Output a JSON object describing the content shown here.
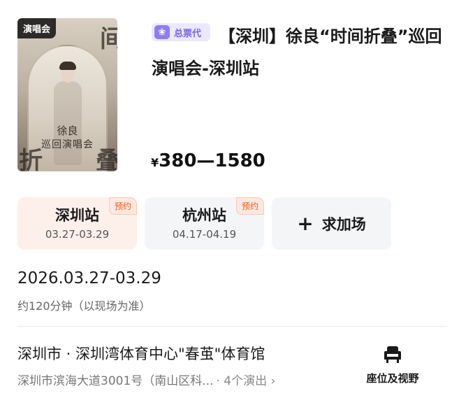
{
  "poster": {
    "tag": "演唱会",
    "title_line1": "徐良",
    "title_line2": "巡回演唱会",
    "char_top": "间",
    "char_bottom_left": "折",
    "char_bottom_right": "叠"
  },
  "badge": {
    "text": "总票代"
  },
  "title": "【深圳】徐良“时间折叠”巡回演唱会-深圳站",
  "price": {
    "currency": "¥",
    "range": "380—1580"
  },
  "cities": [
    {
      "name": "深圳站",
      "date": "03.27-03.29",
      "tag": "预约",
      "selected": true
    },
    {
      "name": "杭州站",
      "date": "04.17-04.19",
      "tag": "预约",
      "selected": false
    }
  ],
  "add_session": {
    "icon": "+",
    "label": "求加场"
  },
  "datetime": "2026.03.27-03.29",
  "duration": "约120分钟（以现场为准）",
  "venue": "深圳市 · 深圳湾体育中心\"春茧\"体育馆",
  "address": {
    "text": "深圳市滨海大道3001号（南山区科...",
    "shows": "· 4个演出 ›"
  },
  "seat": {
    "label": "座位及视野"
  },
  "colors": {
    "badge_bg": "#ece8ff",
    "badge_text": "#7a66e8",
    "tag_text": "#f05a1e",
    "active_card_bg": "#fdf0ea",
    "card_bg": "#f4f5f7"
  }
}
